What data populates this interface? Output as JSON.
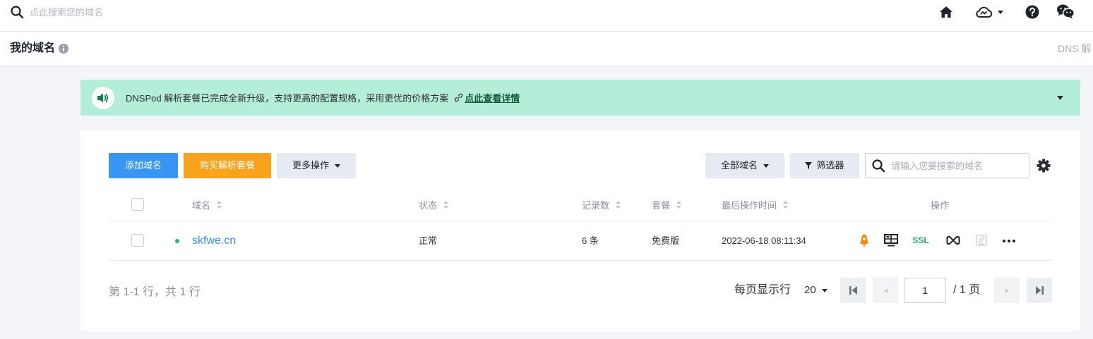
{
  "topbar": {
    "search_placeholder": "点此搜索您的域名",
    "icons": [
      "search-icon",
      "home-icon",
      "cloud-icon",
      "chevron-down-icon",
      "help-icon",
      "wechat-icon"
    ]
  },
  "header": {
    "title": "我的域名",
    "right_tab": "DNS 解",
    "icon": "info-icon"
  },
  "notice": {
    "icon": "speaker-icon",
    "text": "DNSPod 解析套餐已完成全新升级，支持更高的配置规格，采用更优的价格方案",
    "link_icon": "link-icon",
    "link_label": "点此查看详情"
  },
  "toolbar": {
    "add_domain_label": "添加域名",
    "buy_package_label": "购买解析套餐",
    "more_actions_label": "更多操作",
    "all_domains_label": "全部域名",
    "filter_label": "筛选器",
    "search_placeholder": "请输入您要搜索的域名",
    "settings_icon": "gear-icon"
  },
  "table": {
    "columns": [
      {
        "label": "域名",
        "sortable": true
      },
      {
        "label": "状态",
        "sortable": true
      },
      {
        "label": "记录数",
        "sortable": true
      },
      {
        "label": "套餐",
        "sortable": true
      },
      {
        "label": "最后操作时间",
        "sortable": true
      },
      {
        "label": "操作",
        "sortable": false
      }
    ],
    "rows": [
      {
        "domain": "skfwe.cn",
        "status": "正常",
        "records": "6 条",
        "package": "免费版",
        "last_modified": "2022-06-18 08:11:34",
        "checked": false
      }
    ],
    "row_actions": [
      {
        "icon": "rocket-icon"
      },
      {
        "icon": "monitor-icon"
      },
      {
        "icon": "ssl-icon",
        "label": "SSL"
      },
      {
        "icon": "infinity-icon"
      },
      {
        "icon": "edit-note-icon",
        "disabled": true
      },
      {
        "icon": "more-icon"
      }
    ]
  },
  "pagination": {
    "summary": "第 1-1 行，共 1 行",
    "per_page_label": "每页显示行",
    "per_page_value": "20",
    "current_page": "1",
    "total_pages_label": "/ 1 页",
    "icons": [
      "first-page-icon",
      "prev-page-icon",
      "next-page-icon",
      "last-page-icon"
    ]
  },
  "colors": {
    "primary_button": "#3895f4",
    "accent_button": "#f9a21c",
    "notice_background": "#b4edd8",
    "domain_link": "#3a8ee6",
    "status_ok": "#1dbb6a",
    "ssl": "#1fb26b",
    "rocket": "#f08a0b"
  }
}
